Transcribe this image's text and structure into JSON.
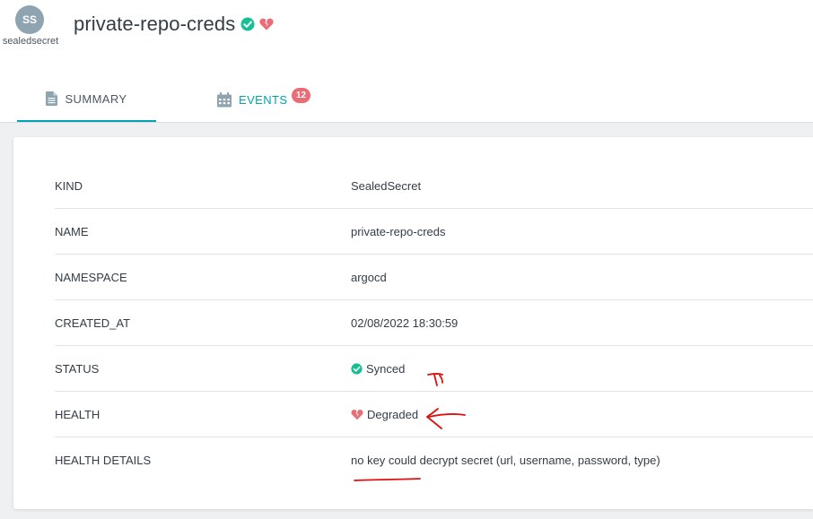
{
  "resource": {
    "avatar_initials": "SS",
    "kind_label": "sealedsecret",
    "title": "private-repo-creds",
    "status_icon": "check-circle-icon",
    "health_icon": "heart-broken-icon"
  },
  "tabs": [
    {
      "label": "SUMMARY",
      "icon": "file-icon",
      "active": true
    },
    {
      "label": "EVENTS",
      "icon": "calendar-icon",
      "active": false,
      "badge": "12"
    }
  ],
  "summary": {
    "rows": [
      {
        "key": "KIND",
        "value": "SealedSecret"
      },
      {
        "key": "NAME",
        "value": "private-repo-creds"
      },
      {
        "key": "NAMESPACE",
        "value": "argocd"
      },
      {
        "key": "CREATED_AT",
        "value": "02/08/2022 18:30:59"
      },
      {
        "key": "STATUS",
        "value": "Synced"
      },
      {
        "key": "HEALTH",
        "value": "Degraded"
      },
      {
        "key": "HEALTH DETAILS",
        "value": "no key could decrypt secret (url, username, password, type)"
      }
    ]
  },
  "colors": {
    "accent": "#00a2b3",
    "synced": "#18be94",
    "degraded": "#e96d76",
    "annotation": "#e01010"
  }
}
